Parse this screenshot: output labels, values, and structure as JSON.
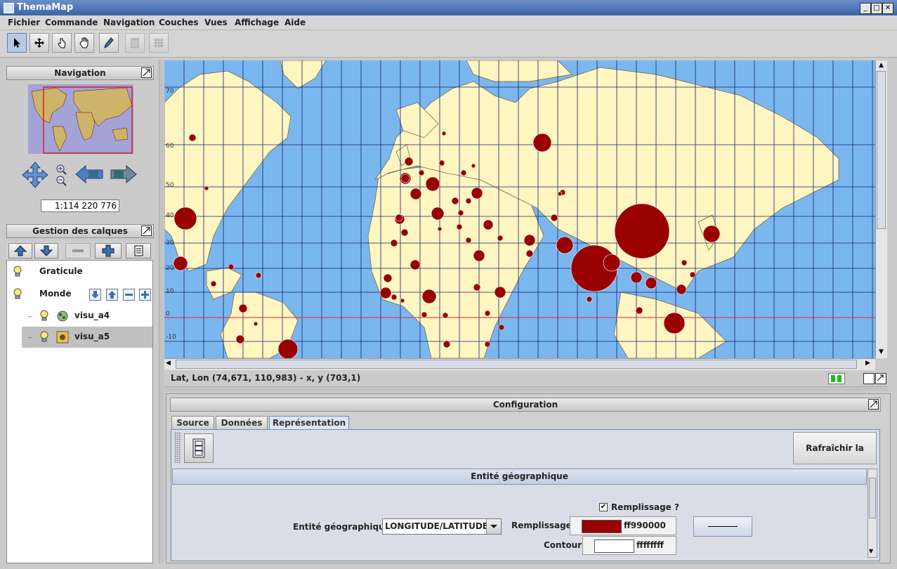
{
  "window": {
    "title": "ThemaMap"
  },
  "menu": [
    "Fichier",
    "Commande",
    "Navigation",
    "Couches",
    "Vues",
    "Affichage",
    "Aide"
  ],
  "toolbar": {
    "tools": [
      "select-arrow-icon",
      "move-cross-icon",
      "grab-hand-icon",
      "pan-hand-icon",
      "pencil-icon",
      "trash-icon",
      "grid-icon"
    ]
  },
  "navigation": {
    "title": "Navigation",
    "scale": "1:114 220 776"
  },
  "layers": {
    "title": "Gestion des calques",
    "items": [
      {
        "label": "Graticule"
      },
      {
        "label": "Monde"
      },
      {
        "label": "visu_a4"
      },
      {
        "label": "visu_a5"
      }
    ]
  },
  "map": {
    "lat_labels": [
      "70",
      "60",
      "50",
      "40",
      "30",
      "20",
      "10",
      "0",
      "-10"
    ],
    "colors": {
      "ocean": "#7bb7ef",
      "land": "#fff6c2",
      "symbol": "#990000"
    }
  },
  "status": {
    "coords": "Lat, Lon (74,671, 110,983) - x, y (703,1)"
  },
  "config": {
    "title": "Configuration",
    "tabs": [
      "Source",
      "Données",
      "Représentation"
    ],
    "refresh_button": "Rafraîchir la carte",
    "section_title": "Entité géographique",
    "fill_checkbox_label": "Remplissage ?",
    "entity_label": "Entité géographique",
    "entity_value": "LONGITUDE/LATITUDE",
    "fill_label": "Remplissage",
    "fill_color": "ff990000",
    "fill_hex": "#990000",
    "contour_label": "Contour",
    "contour_color": "ffffffff",
    "contour_hex": "#ffffff"
  }
}
